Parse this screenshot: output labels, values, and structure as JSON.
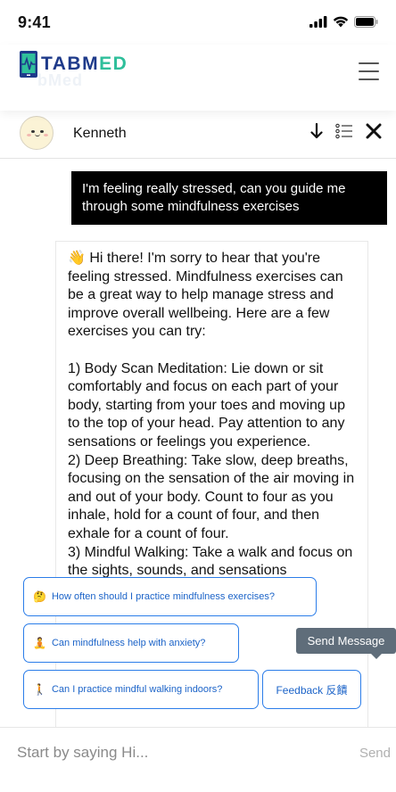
{
  "status": {
    "time": "9:41"
  },
  "app": {
    "logo_text_primary": "TABM",
    "logo_text_accent": "ED",
    "logo_ghost": "bMed",
    "colors": {
      "brand_navy": "#1e3a8a",
      "brand_teal": "#2fbf9b",
      "link_blue": "#2b7de9"
    }
  },
  "chat": {
    "contact_name": "Kenneth"
  },
  "messages": {
    "user": "I'm feeling really stressed, can you guide me through some mindfulness exercises",
    "bot_emoji": "👋",
    "bot": " Hi there! I'm sorry to hear that you're feeling stressed. Mindfulness exercises can be a great way to help manage stress and improve overall wellbeing. Here are a few exercises you can try:\n\n1) Body Scan Meditation: Lie down or sit comfortably and focus on each part of your body, starting from your toes and moving up to the top of your head. Pay attention to any sensations or feelings you experience.\n2) Deep Breathing: Take slow, deep breaths, focusing on the sensation of the air moving in and out of your body. Count to four as you inhale, hold for a count of four, and then exhale for a count of four.\n3) Mindful Walking: Take a walk and focus on the sights, sounds, and sensations"
  },
  "suggestions": [
    {
      "emoji": "🤔",
      "label": "How often should I practice mindfulness exercises?"
    },
    {
      "emoji": "🧘",
      "label": "Can mindfulness help with anxiety?"
    },
    {
      "emoji": "🚶",
      "label": "Can I practice mindful walking indoors?"
    },
    {
      "emoji": "",
      "label": "Feedback 反饋"
    }
  ],
  "tooltip": {
    "text": "Send Message"
  },
  "input": {
    "placeholder": "Start by saying Hi...",
    "send_label": "Send"
  }
}
